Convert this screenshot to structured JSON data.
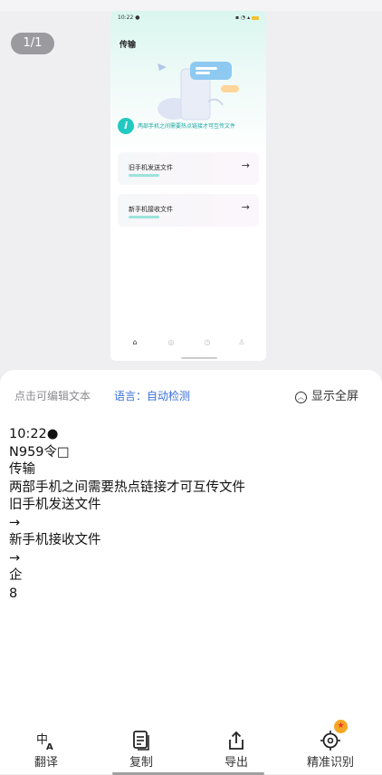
{
  "preview": {
    "page_indicator": "1/1",
    "phone": {
      "status_time": "10:22",
      "title": "传输",
      "info_text": "两部手机之间需要热点链接才可互传文件",
      "cards": [
        {
          "label": "旧手机发送文件",
          "arrow": "→"
        },
        {
          "label": "新手机接收文件",
          "arrow": "→"
        }
      ]
    }
  },
  "sheet": {
    "hint": "点击可编辑文本",
    "language": "语言：自动检测",
    "fullscreen": "显示全屏",
    "ocr_lines": [
      "10:22●",
      "N959令□",
      "传输",
      "两部手机之间需要热点链接才可互传文件",
      "旧手机发送文件",
      "→",
      "新手机接收文件",
      "→",
      "企",
      "8"
    ],
    "actions": {
      "translate": "翻译",
      "copy": "复制",
      "export": "导出",
      "precise": "精准识别"
    }
  },
  "colors": {
    "accent_blue": "#3a6fd8",
    "teal": "#22c9c1",
    "badge_orange": "#f5a623"
  }
}
